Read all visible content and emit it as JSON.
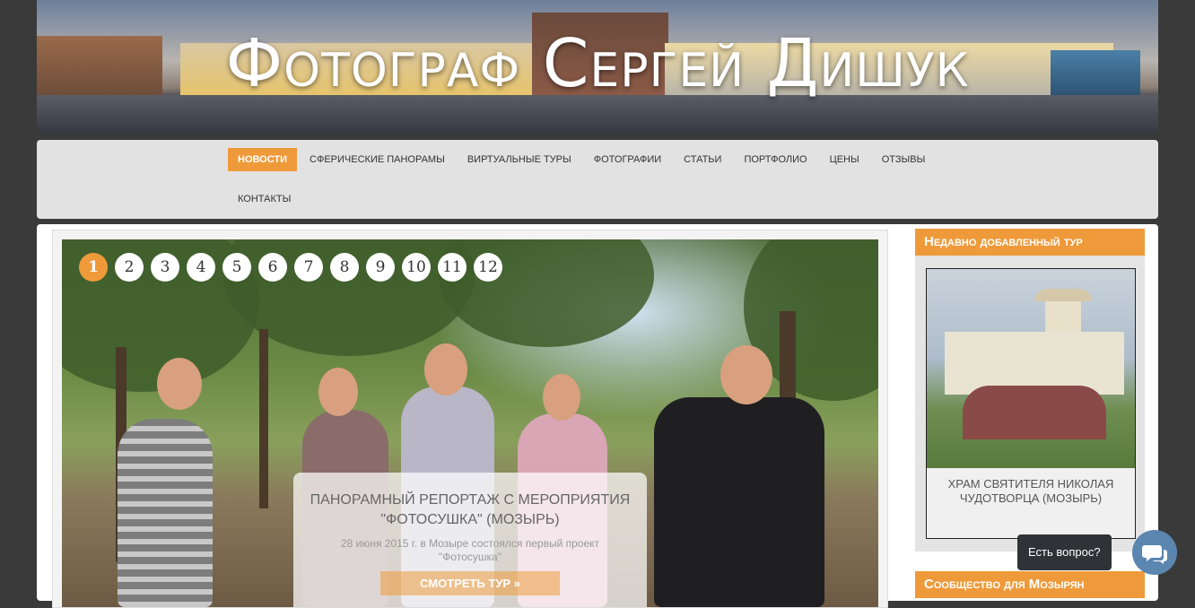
{
  "header": {
    "title": "Фотограф Сергей Дишук"
  },
  "nav": {
    "items": [
      {
        "label": "Новости",
        "active": true
      },
      {
        "label": "Сферические панорамы",
        "active": false
      },
      {
        "label": "Виртуальные туры",
        "active": false
      },
      {
        "label": "Фотографии",
        "active": false
      },
      {
        "label": "Статьи",
        "active": false
      },
      {
        "label": "Портфолио",
        "active": false
      },
      {
        "label": "Цены",
        "active": false
      },
      {
        "label": "Отзывы",
        "active": false
      },
      {
        "label": "Контакты",
        "active": false
      }
    ]
  },
  "slider": {
    "pages": [
      "1",
      "2",
      "3",
      "4",
      "5",
      "6",
      "7",
      "8",
      "9",
      "10",
      "11",
      "12"
    ],
    "active_page": "1",
    "caption": {
      "title": "Панорамный репортаж с мероприятия \"Фотосушка\" (Мозырь)",
      "description": "28 июня 2015 г. в Мозыре состоялся первый проект \"Фотосушка\"",
      "button": "Смотреть тур »"
    }
  },
  "sidebar": {
    "recent_tour": {
      "heading": "Недавно добавленный тур",
      "tour_title": "Храм святителя Николая Чудотворца (Мозырь)"
    },
    "community": {
      "heading": "Сообщество для Мозырян"
    }
  },
  "chat": {
    "ask_label": "Есть вопрос?",
    "icon": "chat-bubbles-icon"
  },
  "colors": {
    "accent": "#ef9a3a",
    "nav_bg": "#e2e2e2",
    "page_bg": "#3a3a3a",
    "chat": "#5b86b0"
  }
}
